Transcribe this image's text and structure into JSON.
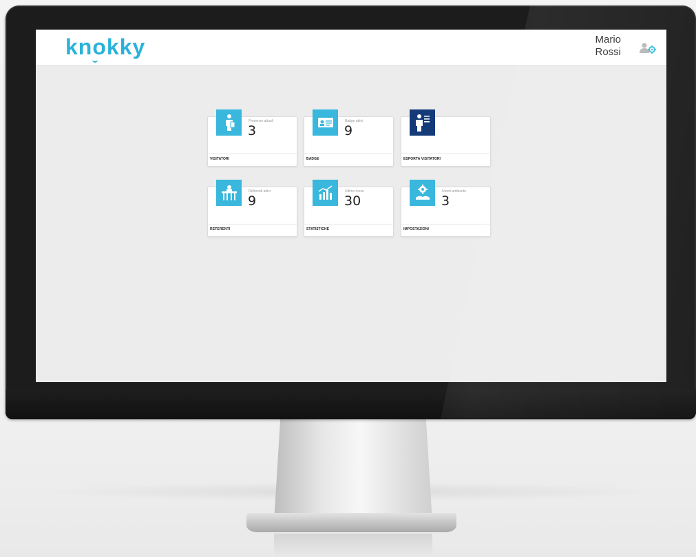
{
  "app": {
    "logo": "knokky"
  },
  "header": {
    "user_first": "Mario",
    "user_last": "Rossi",
    "icon": "user-settings-icon"
  },
  "colors": {
    "accent": "#3ab7dc",
    "dark_accent": "#143a7a",
    "logo": "#2bb2da"
  },
  "tiles": [
    {
      "label": "VISITATORI",
      "sublabel": "Presenze attuali",
      "value": "3",
      "icon": "visitor-icon"
    },
    {
      "label": "BADGE",
      "sublabel": "Badge attivi",
      "value": "9",
      "icon": "badge-icon"
    },
    {
      "label": "ESPORTA VISITATORI",
      "sublabel": "",
      "value": "",
      "icon": "export-visitors-icon"
    },
    {
      "label": "REFERENTI",
      "sublabel": "Referenti attivi",
      "value": "9",
      "icon": "referent-icon"
    },
    {
      "label": "STATISTICHE",
      "sublabel": "Ultimo mese",
      "value": "30",
      "icon": "statistics-icon"
    },
    {
      "label": "IMPOSTAZIONI",
      "sublabel": "Utenti ambiente",
      "value": "3",
      "icon": "settings-icon"
    }
  ]
}
